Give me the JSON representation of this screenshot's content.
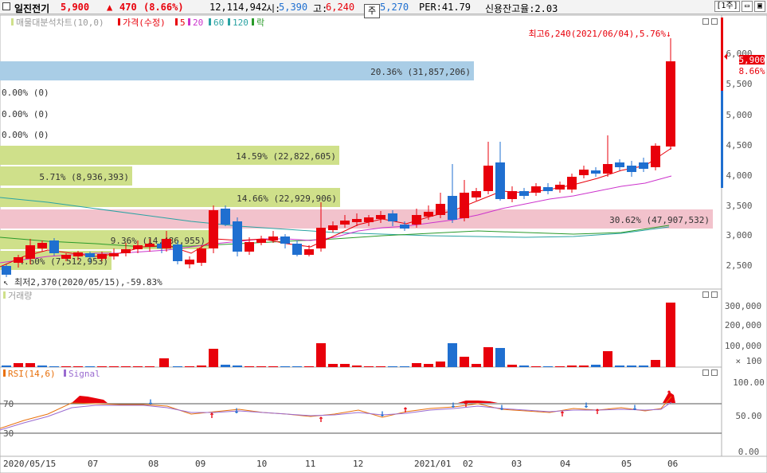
{
  "header": {
    "stock_name": "일진전기",
    "price": "5,900",
    "change_arrow": "▲",
    "change": "470",
    "change_pct": "(8.66%)",
    "volume": "12,114,942",
    "open_label": "시:",
    "open": "5,390",
    "high_label": "고:",
    "high": "6,240",
    "low_partial": "5,270",
    "per": "PER:41.79",
    "credit": "신용잔고율:2.03",
    "period_button": "[1주]",
    "tooltip": "주"
  },
  "price_panel": {
    "legend": [
      "매물대분석차트(10,0)",
      "가격(수정)",
      "5",
      "20",
      "60",
      "120",
      "락"
    ],
    "high_annotation": "최고6,240(2021/06/04),5.76%",
    "low_annotation": "최저2,370(2020/05/15),-59.83%",
    "current_price_tag": "5,900",
    "current_pct_tag": "8.66%",
    "y_ticks": [
      "6,000",
      "5,500",
      "5,000",
      "4,500",
      "4,000",
      "3,500",
      "3,000",
      "2,500"
    ],
    "volume_profile": [
      "20.36% (31,857,206)",
      "0.00% (0)",
      "0.00% (0)",
      "0.00% (0)",
      "14.59% (22,822,605)",
      "5.71% (8,936,393)",
      "14.66% (22,929,906)",
      "30.62% (47,907,532)",
      "9.36% (14,486,955)",
      "4.60% (7,512,953)"
    ]
  },
  "volume_panel": {
    "legend": "거래량",
    "y_ticks": [
      "300,000",
      "200,000",
      "100,000",
      "× 100"
    ]
  },
  "rsi_panel": {
    "legend_rsi": "RSI(14,6)",
    "legend_signal": "Signal",
    "level_high": "70",
    "level_low": "30",
    "y_ticks": [
      "100.00",
      "50.00",
      "0.00"
    ]
  },
  "x_axis": [
    "2020/05/15",
    "07",
    "08",
    "09",
    "10",
    "11",
    "12",
    "2021/01",
    "02",
    "03",
    "04",
    "05",
    "06"
  ],
  "colors": {
    "up": "#e8000b",
    "down": "#1f6fd0",
    "ma5": "#e8000b",
    "ma20": "#cc33cc",
    "ma60": "#2aa3a3",
    "ma120": "#2a9a2a",
    "profile_blue": "#a9cde6",
    "profile_green": "#cfe08a",
    "profile_pink": "#f2c2cc"
  }
}
